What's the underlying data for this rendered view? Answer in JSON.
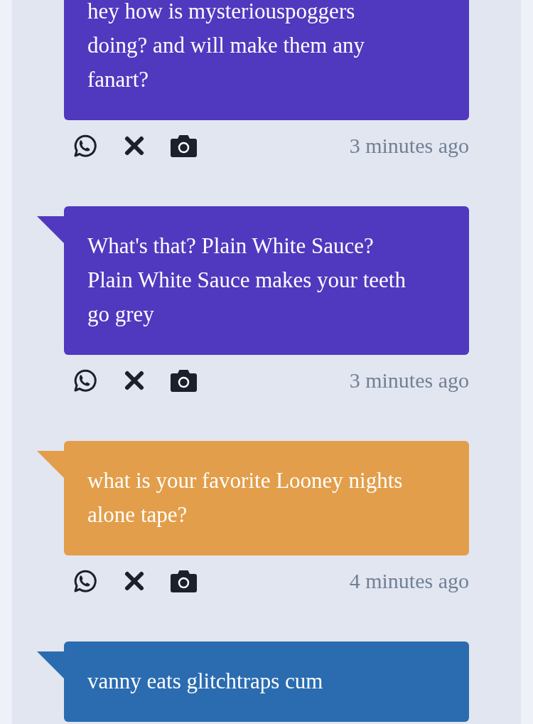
{
  "messages": [
    {
      "text": "hey how is mysteriouspoggers doing? and will make them any fanart?",
      "color": "#5039bf",
      "tail": false,
      "time": "3 minutes ago"
    },
    {
      "text": "What's that? Plain White Sauce? Plain White Sauce makes your teeth go grey",
      "color": "#5039bf",
      "tail": true,
      "time": "3 minutes ago"
    },
    {
      "text": "what is your favorite Looney nights alone tape?",
      "color": "#e29e4a",
      "tail": true,
      "time": "4 minutes ago"
    },
    {
      "text": "vanny eats glitchtraps cum",
      "color": "#2b6cb0",
      "tail": true
    }
  ]
}
